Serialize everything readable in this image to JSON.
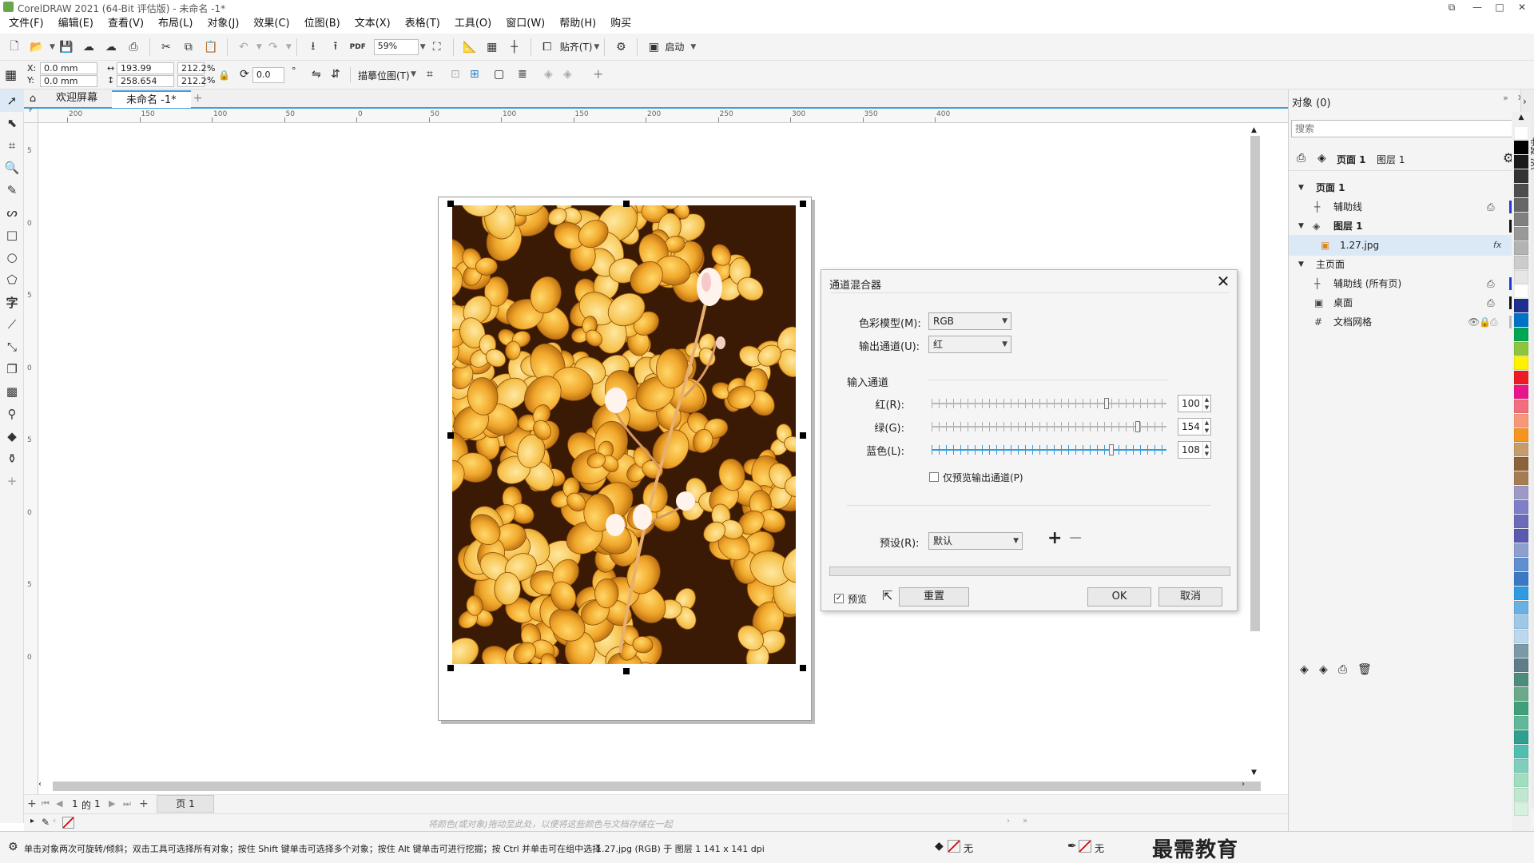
{
  "window": {
    "title": "CorelDRAW 2021 (64-Bit 评估版) - 未命名 -1*"
  },
  "menu": [
    "文件(F)",
    "编辑(E)",
    "查看(V)",
    "布局(L)",
    "对象(J)",
    "效果(C)",
    "位图(B)",
    "文本(X)",
    "表格(T)",
    "工具(O)",
    "窗口(W)",
    "帮助(H)",
    "购买"
  ],
  "toolbar": {
    "zoom": "59%",
    "snap_label": "贴齐(T)",
    "launch_label": "启动",
    "pdf_label": "PDF"
  },
  "property_bar": {
    "x": "0.0 mm",
    "y": "0.0 mm",
    "x_label": "X:",
    "y_label": "Y:",
    "width": "193.99 mm",
    "height": "258.654 mm",
    "scale_w": "212.2",
    "scale_h": "212.2",
    "percent": "%",
    "angle": "0.0",
    "degree": "°",
    "trace_label": "描摹位图(T)"
  },
  "tabs": {
    "welcome": "欢迎屏幕",
    "document": "未命名 -1*"
  },
  "ruler": {
    "h_labels": [
      "200",
      "150",
      "100",
      "50",
      "0",
      "50",
      "100",
      "150",
      "200",
      "250",
      "300",
      "350",
      "400"
    ],
    "v_labels": [
      "5",
      "0",
      "5",
      "0",
      "5",
      "0",
      "5",
      "0"
    ]
  },
  "dialog": {
    "title": "通道混合器",
    "color_model_label": "色彩模型(M):",
    "color_model_value": "RGB",
    "output_channel_label": "输出通道(U):",
    "output_channel_value": "红",
    "input_channels_label": "输入通道",
    "channels": [
      {
        "label": "红(R):",
        "value": "100",
        "fraction": 0.75
      },
      {
        "label": "绿(G):",
        "value": "154",
        "fraction": 0.885
      },
      {
        "label": "蓝色(L):",
        "value": "108",
        "fraction": 0.77
      }
    ],
    "preview_output_label": "仅预览输出通道(P)",
    "preset_label": "预设(R):",
    "preset_value": "默认",
    "preview_label": "预览",
    "reset_label": "重置",
    "ok_label": "OK",
    "cancel_label": "取消"
  },
  "docker": {
    "title": "对象 (0)",
    "search_placeholder": "搜索",
    "header_page": "页面 1",
    "header_layer": "图层 1",
    "rows": [
      {
        "label": "页面 1",
        "bold": true
      },
      {
        "label": "辅助线"
      },
      {
        "label": "图层 1",
        "bold": true
      },
      {
        "label": "1.27.jpg",
        "fx": "fx"
      },
      {
        "label": "主页面"
      },
      {
        "label": "辅助线 (所有页)"
      },
      {
        "label": "桌面"
      },
      {
        "label": "文档网格"
      }
    ]
  },
  "pagebar": {
    "current": "1",
    "of": "的",
    "total": "1",
    "page_tab": "页 1"
  },
  "hint": "将颜色(或对象)拖动至此处，以便将这些颜色与文档存储在一起",
  "status": {
    "message": "单击对象两次可旋转/倾斜；双击工具可选择所有对象；按住 Shift 键单击可选择多个对象；按住 Alt 键单击可进行挖掘；按 Ctrl 并单击可在组中选择",
    "info": "1.27.jpg (RGB) 于 图层 1 141 x 141 dpi",
    "fill": "无",
    "outline": "无"
  },
  "watermark": "最需教育",
  "palette": [
    "#ffffff",
    "#000000",
    "#1a1a1a",
    "#333333",
    "#4d4d4d",
    "#666666",
    "#808080",
    "#999999",
    "#b3b3b3",
    "#cccccc",
    "#e6e6e6",
    "#ffffff",
    "#1f2f8f",
    "#0073c6",
    "#00a651",
    "#8cc63f",
    "#fff200",
    "#ed1c24",
    "#e8168a",
    "#f26d7d",
    "#f7977a",
    "#f7941d",
    "#c69c6d",
    "#8c6239",
    "#a67c52",
    "#9e9ac8",
    "#7f7fc8",
    "#6b6bb8",
    "#5a5ab0",
    "#8e9fd0",
    "#5e8fd0",
    "#3a79c6",
    "#2e9be0",
    "#6ab0e0",
    "#9ec8e8",
    "#bcd7ee",
    "#7a9aa8",
    "#5e7c8a",
    "#4a8d7a",
    "#6aaa8a",
    "#3fa07a",
    "#5fb89a",
    "#2f9f8f",
    "#4fbfaf",
    "#7fcfbf",
    "#9fdfbf",
    "#c0e8d0",
    "#d8f0e0"
  ]
}
